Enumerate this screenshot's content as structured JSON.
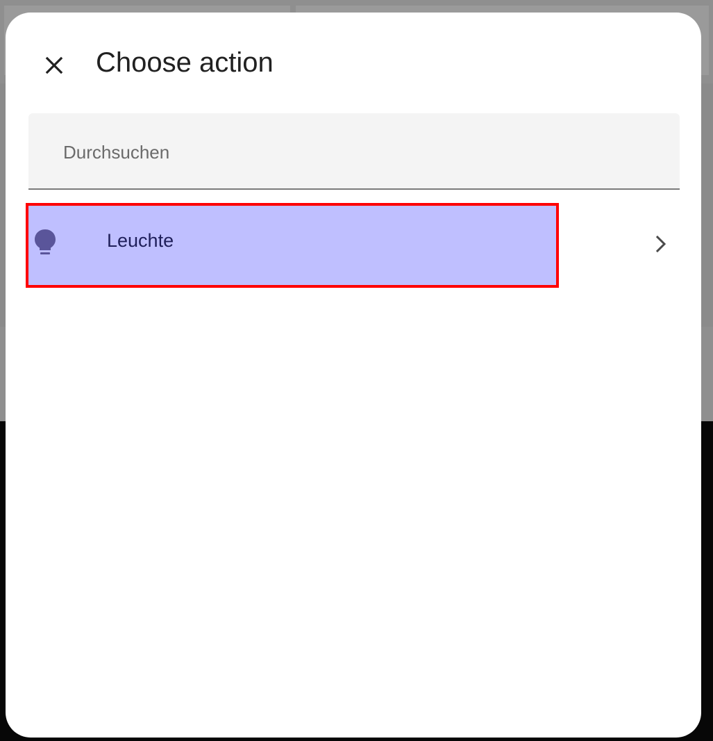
{
  "dialog": {
    "title": "Choose action",
    "close_icon": "close-icon"
  },
  "search": {
    "placeholder": "Durchsuchen",
    "value": ""
  },
  "actions": [
    {
      "label": "Leuchte",
      "icon": "lightbulb-icon",
      "trailing_icon": "chevron-right-icon",
      "highlighted": true
    }
  ],
  "colors": {
    "highlight_fill": "#bfbfff",
    "highlight_border": "#ff0000",
    "icon_color": "#5a559a"
  }
}
